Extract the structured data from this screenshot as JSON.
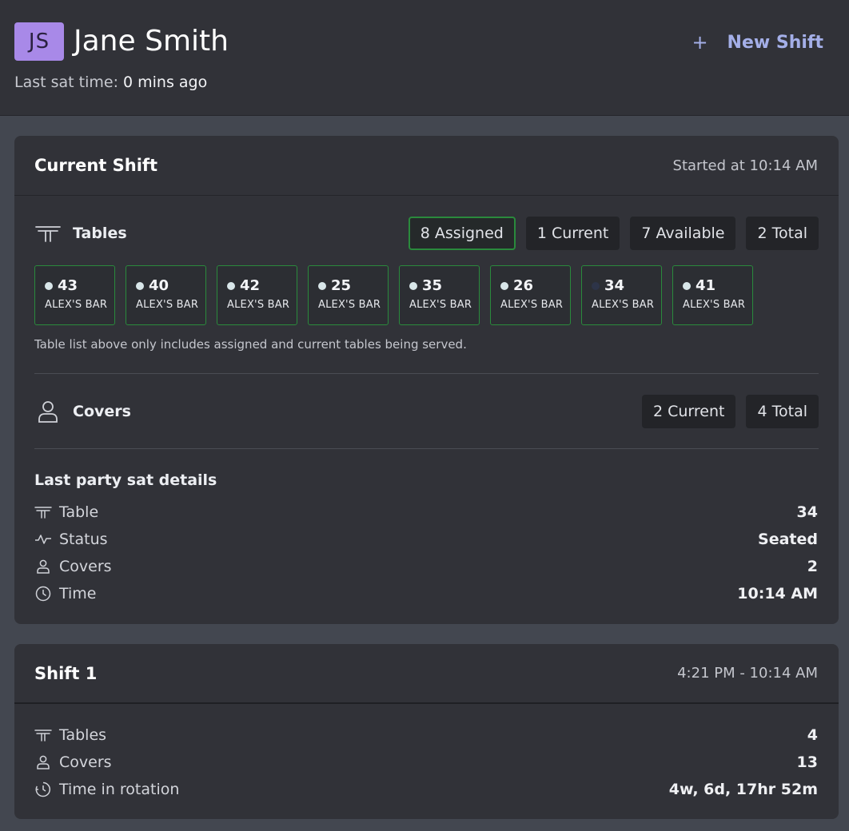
{
  "header": {
    "avatar_initials": "JS",
    "name": "Jane Smith",
    "new_shift_plus": "+",
    "new_shift_label": "New Shift",
    "last_sat_label": "Last sat time:",
    "last_sat_value": "0 mins ago"
  },
  "current_shift": {
    "title": "Current Shift",
    "started": "Started at 10:14 AM",
    "tables": {
      "label": "Tables",
      "pills": [
        "8 Assigned",
        "1 Current",
        "7 Available",
        "2 Total"
      ],
      "items": [
        {
          "num": "43",
          "loc": "ALEX'S BAR"
        },
        {
          "num": "40",
          "loc": "ALEX'S BAR"
        },
        {
          "num": "42",
          "loc": "ALEX'S BAR"
        },
        {
          "num": "25",
          "loc": "ALEX'S BAR"
        },
        {
          "num": "35",
          "loc": "ALEX'S BAR"
        },
        {
          "num": "26",
          "loc": "ALEX'S BAR"
        },
        {
          "num": "34",
          "loc": "ALEX'S BAR"
        },
        {
          "num": "41",
          "loc": "ALEX'S BAR"
        }
      ],
      "note": "Table list above only includes assigned and current tables being served."
    },
    "covers": {
      "label": "Covers",
      "pills": [
        "2 Current",
        "4 Total"
      ]
    },
    "last_party": {
      "title": "Last party sat details",
      "rows": [
        {
          "label": "Table",
          "value": "34",
          "icon": "table-icon"
        },
        {
          "label": "Status",
          "value": "Seated",
          "icon": "activity-icon"
        },
        {
          "label": "Covers",
          "value": "2",
          "icon": "person-icon"
        },
        {
          "label": "Time",
          "value": "10:14 AM",
          "icon": "clock-icon"
        }
      ]
    }
  },
  "shift1": {
    "title": "Shift 1",
    "range": "4:21 PM - 10:14 AM",
    "rows": [
      {
        "label": "Tables",
        "value": "4",
        "icon": "table-icon"
      },
      {
        "label": "Covers",
        "value": "13",
        "icon": "person-icon"
      },
      {
        "label": "Time in rotation",
        "value": "4w, 6d, 17hr 52m",
        "icon": "timer-icon"
      }
    ]
  },
  "colors": {
    "accent": "#a4afe8",
    "avatar": "#a889e8",
    "assigned_border": "#2a8a3c"
  }
}
